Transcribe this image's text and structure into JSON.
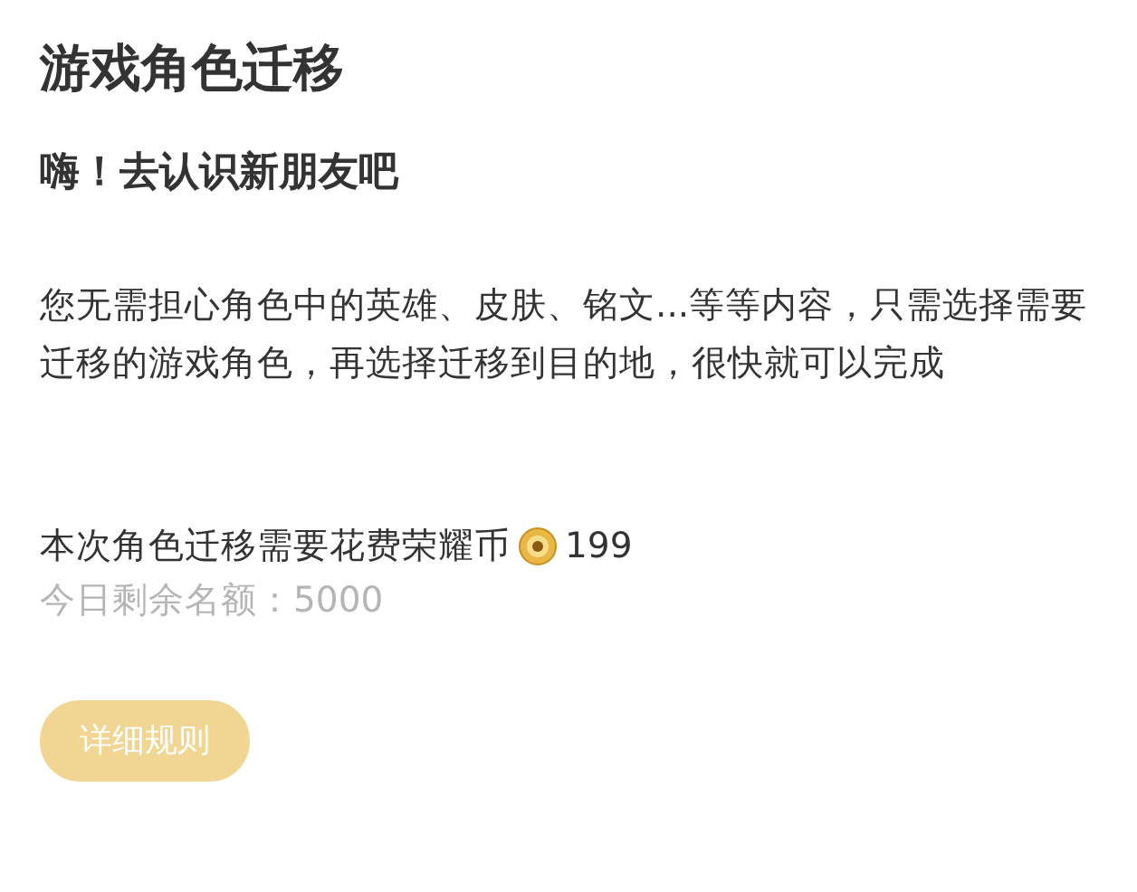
{
  "title": "游戏角色迁移",
  "subtitle": "嗨！去认识新朋友吧",
  "description": "您无需担心角色中的英雄、皮肤、铭文...等等内容，只需选择需要迁移的游戏角色，再选择迁移到目的地，很快就可以完成",
  "cost": {
    "label": "本次角色迁移需要花费荣耀币",
    "amount": "199"
  },
  "quota": "今日剩余名额：5000",
  "button": {
    "label": "详细规则",
    "disabled": true
  }
}
